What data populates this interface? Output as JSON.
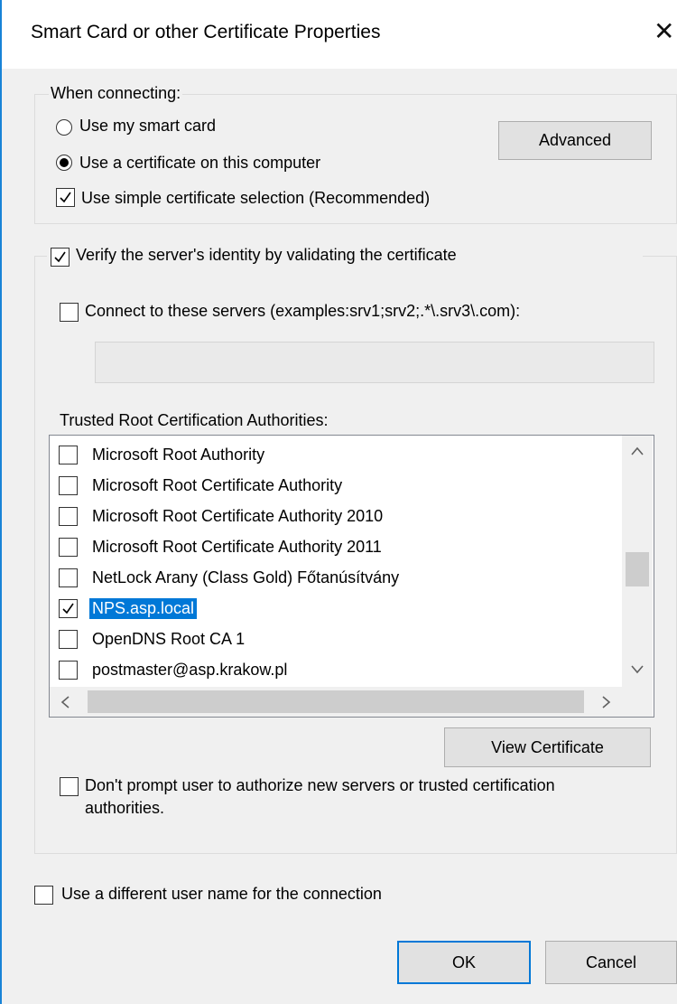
{
  "window": {
    "title": "Smart Card or other Certificate Properties",
    "close_glyph": "✕"
  },
  "connecting": {
    "group_title": "When connecting:",
    "use_smart_card_label": "Use my smart card",
    "use_certificate_label": "Use a certificate on this computer",
    "selected": "Use a certificate on this computer",
    "simple_selection_label": "Use simple certificate selection (Recommended)",
    "simple_selection_checked": true,
    "advanced_button": "Advanced"
  },
  "verify": {
    "label": "Verify the server's identity by validating the certificate",
    "checked": true,
    "connect_servers_label": "Connect to these servers (examples:srv1;srv2;.*\\.srv3\\.com):",
    "connect_servers_checked": false,
    "servers_value": "",
    "trusted_root_label": "Trusted Root Certification Authorities:",
    "authorities": [
      {
        "name": "Microsoft Root Authority",
        "checked": false,
        "selected": false
      },
      {
        "name": "Microsoft Root Certificate Authority",
        "checked": false,
        "selected": false
      },
      {
        "name": "Microsoft Root Certificate Authority 2010",
        "checked": false,
        "selected": false
      },
      {
        "name": "Microsoft Root Certificate Authority 2011",
        "checked": false,
        "selected": false
      },
      {
        "name": "NetLock Arany (Class Gold) Főtanúsítvány",
        "checked": false,
        "selected": false
      },
      {
        "name": "NPS.asp.local",
        "checked": true,
        "selected": true
      },
      {
        "name": "OpenDNS Root CA 1",
        "checked": false,
        "selected": false
      },
      {
        "name": "postmaster@asp.krakow.pl",
        "checked": false,
        "selected": false
      }
    ],
    "view_certificate_button": "View Certificate",
    "dont_prompt_label_line1": "Don't prompt user to authorize new servers or trusted certification",
    "dont_prompt_label_line2": "authorities.",
    "dont_prompt_checked": false
  },
  "different_user_label": "Use a different user name for the connection",
  "different_user_checked": false,
  "buttons": {
    "ok": "OK",
    "cancel": "Cancel"
  },
  "colors": {
    "accent": "#0078d7",
    "window_border": "#1883d7",
    "background": "#f0f0f0"
  }
}
